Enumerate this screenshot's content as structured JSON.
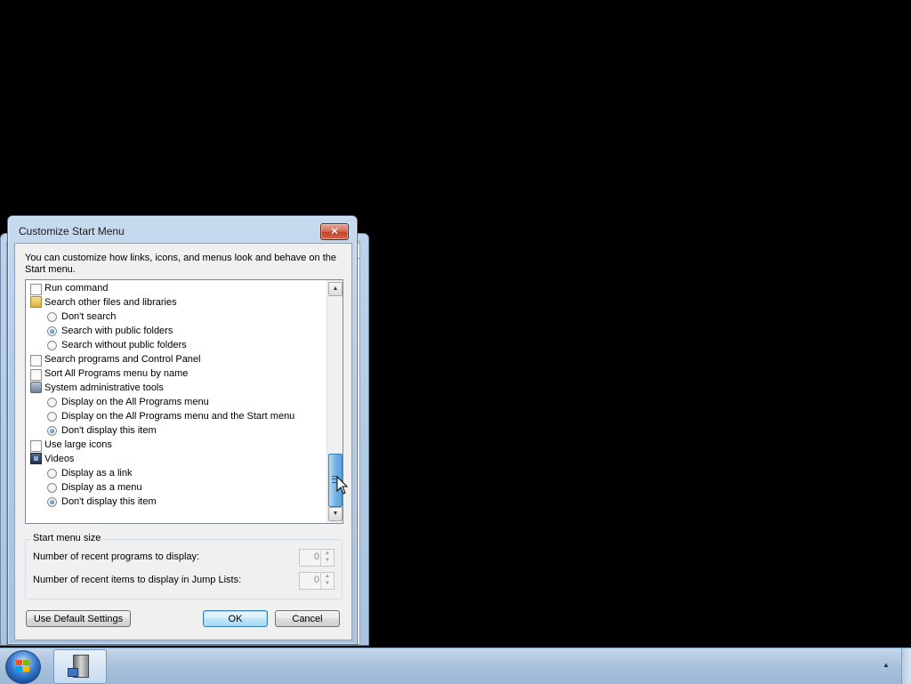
{
  "dialog": {
    "title": "Customize Start Menu",
    "close_glyph": "✕",
    "description": "You can customize how links, icons, and menus look and behave on the Start menu."
  },
  "options": [
    {
      "kind": "checkbox",
      "label": "Run command",
      "checked": false,
      "indent": 0
    },
    {
      "kind": "group",
      "icon": "folder-search-icon",
      "label": "Search other files and libraries",
      "indent": 0
    },
    {
      "kind": "radio",
      "label": "Don't search",
      "checked": false,
      "indent": 1
    },
    {
      "kind": "radio",
      "label": "Search with public folders",
      "checked": true,
      "indent": 1
    },
    {
      "kind": "radio",
      "label": "Search without public folders",
      "checked": false,
      "indent": 1
    },
    {
      "kind": "checkbox",
      "label": "Search programs and Control Panel",
      "checked": false,
      "indent": 0
    },
    {
      "kind": "checkbox",
      "label": "Sort All Programs menu by name",
      "checked": false,
      "indent": 0
    },
    {
      "kind": "group",
      "icon": "admin-tools-icon",
      "label": "System administrative tools",
      "indent": 0
    },
    {
      "kind": "radio",
      "label": "Display on the All Programs menu",
      "checked": false,
      "indent": 1
    },
    {
      "kind": "radio",
      "label": "Display on the All Programs menu and the Start menu",
      "checked": false,
      "indent": 1
    },
    {
      "kind": "radio",
      "label": "Don't display this item",
      "checked": true,
      "indent": 1
    },
    {
      "kind": "checkbox",
      "label": "Use large icons",
      "checked": false,
      "indent": 0
    },
    {
      "kind": "group",
      "icon": "videos-icon",
      "label": "Videos",
      "indent": 0
    },
    {
      "kind": "radio",
      "label": "Display as a link",
      "checked": false,
      "indent": 1
    },
    {
      "kind": "radio",
      "label": "Display as a menu",
      "checked": false,
      "indent": 1
    },
    {
      "kind": "radio",
      "label": "Don't display this item",
      "checked": true,
      "indent": 1
    }
  ],
  "scrollbar": {
    "up_glyph": "▲",
    "down_glyph": "▼",
    "position_fraction": 1.0
  },
  "start_menu_size": {
    "group_title": "Start menu size",
    "recent_programs_label": "Number of recent programs to display:",
    "recent_programs_value": "0",
    "recent_items_label": "Number of recent items to display in Jump Lists:",
    "recent_items_value": "0",
    "spin_up": "▲",
    "spin_down": "▼"
  },
  "buttons": {
    "default_settings": "Use Default Settings",
    "ok": "OK",
    "cancel": "Cancel"
  },
  "taskbar": {
    "tray_arrow": "▲"
  }
}
